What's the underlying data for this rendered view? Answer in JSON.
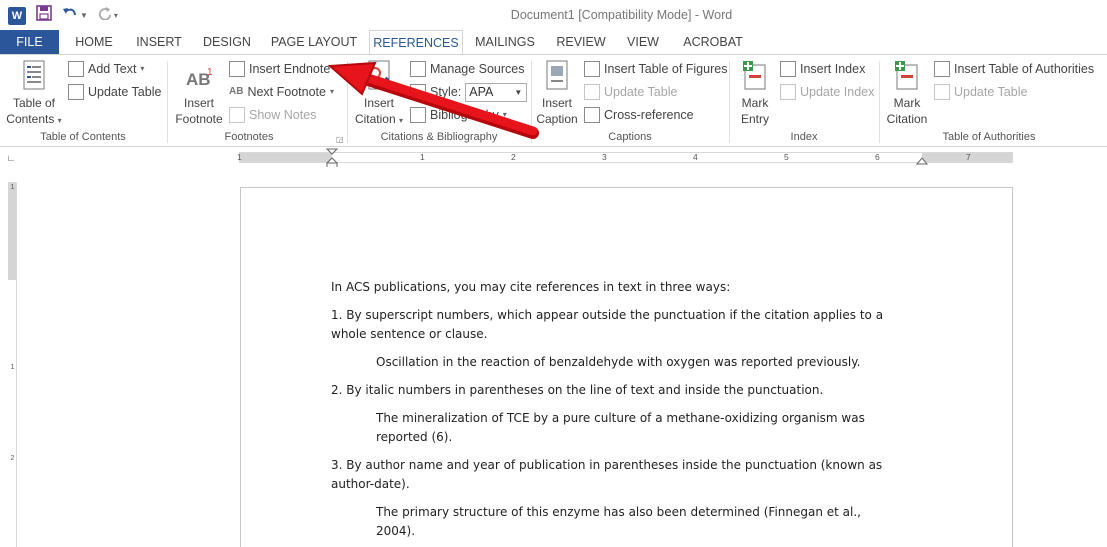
{
  "app": {
    "title": "Document1 [Compatibility Mode] - Word",
    "logo_letter": "W"
  },
  "qat": {
    "save_icon": "save-icon",
    "undo_icon": "undo-icon",
    "redo_icon": "redo-icon"
  },
  "tabs": [
    {
      "label": "FILE"
    },
    {
      "label": "HOME"
    },
    {
      "label": "INSERT"
    },
    {
      "label": "DESIGN"
    },
    {
      "label": "PAGE LAYOUT"
    },
    {
      "label": "REFERENCES"
    },
    {
      "label": "MAILINGS"
    },
    {
      "label": "REVIEW"
    },
    {
      "label": "VIEW"
    },
    {
      "label": "ACROBAT"
    }
  ],
  "active_tab": "REFERENCES",
  "ribbon": {
    "toc": {
      "table_of_contents_line1": "Table of",
      "table_of_contents_line2": "Contents",
      "add_text": "Add Text",
      "update_table": "Update Table",
      "group_label": "Table of Contents"
    },
    "footnotes": {
      "insert_footnote_line1": "Insert",
      "insert_footnote_line2": "Footnote",
      "insert_endnote": "Insert Endnote",
      "next_footnote": "Next Footnote",
      "show_notes": "Show Notes",
      "group_label": "Footnotes"
    },
    "citations": {
      "insert_citation_line1": "Insert",
      "insert_citation_line2": "Citation",
      "manage_sources": "Manage Sources",
      "style_label": "Style:",
      "style_value": "APA",
      "bibliography": "Bibliography",
      "group_label": "Citations & Bibliography"
    },
    "captions": {
      "insert_caption_line1": "Insert",
      "insert_caption_line2": "Caption",
      "insert_table_of_figures": "Insert Table of Figures",
      "update_table": "Update Table",
      "cross_reference": "Cross-reference",
      "group_label": "Captions"
    },
    "index": {
      "mark_entry_line1": "Mark",
      "mark_entry_line2": "Entry",
      "insert_index": "Insert Index",
      "update_index": "Update Index",
      "group_label": "Index"
    },
    "authorities": {
      "mark_citation_line1": "Mark",
      "mark_citation_line2": "Citation",
      "insert_table_of_authorities": "Insert Table of Authorities",
      "update_table": "Update Table",
      "group_label": "Table of Authorities"
    }
  },
  "ruler": {
    "numbers": [
      "1",
      "1",
      "2",
      "3",
      "4",
      "5",
      "6",
      "7"
    ],
    "vertical_numbers": [
      "1",
      "1",
      "2"
    ]
  },
  "document": {
    "paragraphs": [
      {
        "text": "In ACS publications, you may cite references in text in three ways:",
        "indent": false
      },
      {
        "text": "1. By superscript numbers, which appear outside the punctuation if the citation applies to a whole sentence or clause.",
        "indent": false
      },
      {
        "text": "Oscillation in the reaction of benzaldehyde with oxygen was reported previously.",
        "indent": true
      },
      {
        "text": "2. By italic numbers in parentheses on the line of text and inside the punctuation.",
        "indent": false
      },
      {
        "text": "The mineralization of TCE by a pure culture of a methane-oxidizing organism was reported (6).",
        "indent": true
      },
      {
        "text": "3. By author name and year of publication in parentheses inside the punctuation (known as author-date).",
        "indent": false
      },
      {
        "text": "The primary structure of this enzyme has also been determined (Finnegan et al., 2004).",
        "indent": true
      }
    ]
  },
  "colors": {
    "accent": "#2b579a",
    "annotation_arrow": "#e8141b"
  }
}
